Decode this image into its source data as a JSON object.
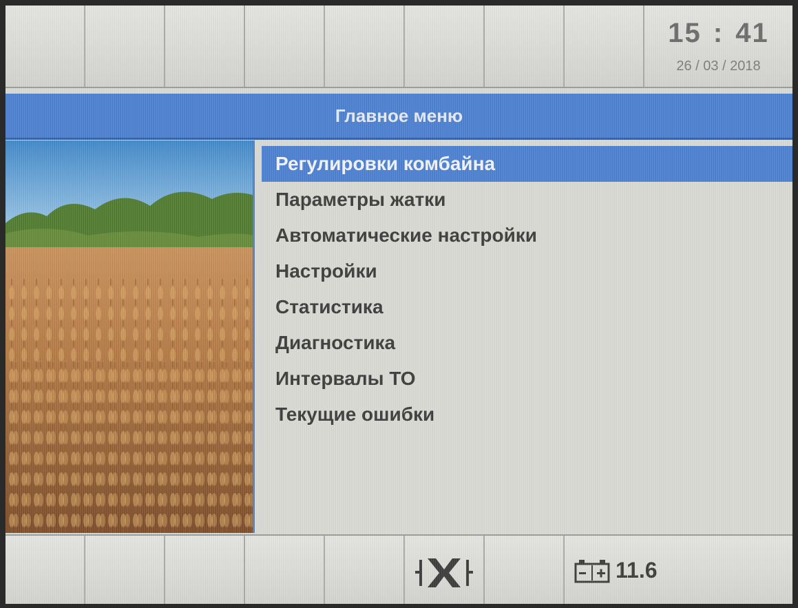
{
  "status_bar": {
    "time": "15 : 41",
    "date": "26 / 03 / 2018"
  },
  "title": "Главное меню",
  "menu": {
    "selected_index": 0,
    "items": [
      {
        "label": "Регулировки комбайна"
      },
      {
        "label": "Параметры жатки"
      },
      {
        "label": "Автоматические настройки"
      },
      {
        "label": "Настройки"
      },
      {
        "label": "Статистика"
      },
      {
        "label": "Диагностика"
      },
      {
        "label": "Интервалы ТО"
      },
      {
        "label": "Текущие ошибки"
      }
    ]
  },
  "bottom_bar": {
    "battery_voltage": "11.6",
    "icons": [
      "header-lock-icon",
      "battery-icon"
    ]
  },
  "colors": {
    "accent": "#4a7fd0",
    "panel": "#d9d9d4",
    "text": "#3a3a3a"
  }
}
